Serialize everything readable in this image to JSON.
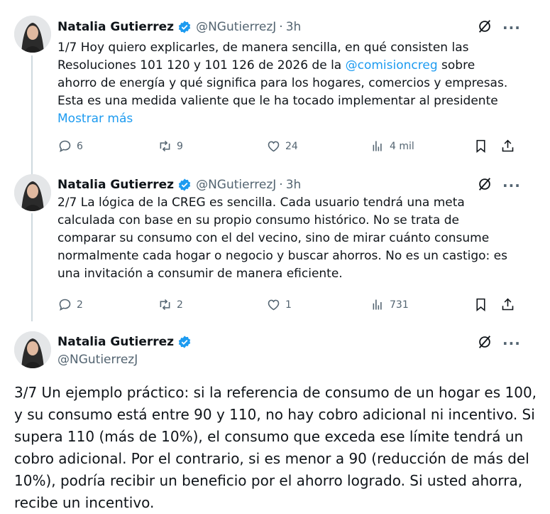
{
  "author": {
    "name": "Natalia Gutierrez",
    "handle": "@NGutierrezJ",
    "separator": "·",
    "time": "3h"
  },
  "tweets": [
    {
      "text_before": "1/7 Hoy quiero explicarles, de manera sencilla, en qué consisten las Resoluciones 101 120 y 101 126 de 2026 de la ",
      "mention": "@comisioncreg",
      "text_after": " sobre ahorro de energía y qué significa para los hogares, comercios y empresas. Esta es una medida valiente que le ha tocado implementar al presidente",
      "show_more": "Mostrar más",
      "replies": "6",
      "reposts": "9",
      "likes": "24",
      "views": "4 mil"
    },
    {
      "text": "2/7 La lógica de la CREG es sencilla. Cada usuario tendrá una meta calculada con base en su propio consumo histórico. No se trata de comparar su consumo con el del vecino, sino de mirar cuánto consume normalmente cada hogar o negocio y buscar ahorros. No es un castigo: es una invitación a consumir de manera eficiente.",
      "replies": "2",
      "reposts": "2",
      "likes": "1",
      "views": "731"
    },
    {
      "text": "3/7 Un ejemplo práctico: si la referencia de consumo de un hogar es 100, y su consumo está entre 90 y 110, no hay cobro adicional ni incentivo. Si supera 110 (más de 10%), el consumo que exceda ese límite tendrá un cobro adicional. Por el contrario, si es menor a 90 (reducción de más del 10%), podría recibir un beneficio por el ahorro logrado. Si usted ahorra, recibe un incentivo."
    }
  ],
  "more_icon": "···",
  "colors": {
    "link": "#1d9bf0",
    "verified": "#1d9bf0",
    "muted": "#536471",
    "line": "#cfd9de"
  }
}
